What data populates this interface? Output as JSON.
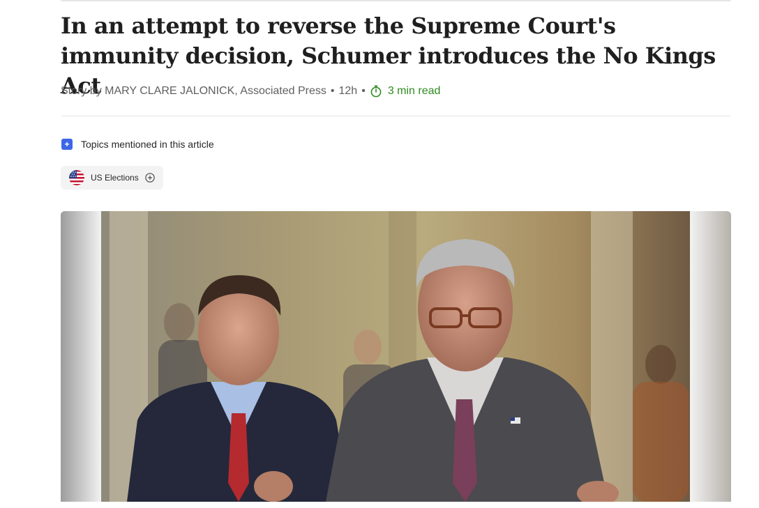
{
  "article": {
    "headline": "In an attempt to reverse the Supreme Court's immunity decision, Schumer introduces the No Kings Act",
    "byline_prefix": "Story by MARY CLARE JALONICK, Associated Press",
    "byline_sep": "•",
    "age": "12h",
    "read_time": "3 min read",
    "read_time_icon": "stopwatch-icon"
  },
  "topics": {
    "heading": "Topics mentioned in this article",
    "heading_icon": "plus-square-icon",
    "items": [
      {
        "label": "US Elections",
        "icon": "us-flag-icon",
        "action_icon": "add-circle-icon"
      }
    ]
  },
  "photo": {
    "subject": "press-photo"
  },
  "colors": {
    "accent_green": "#2e8b1f",
    "accent_blue": "#3b66e6"
  }
}
